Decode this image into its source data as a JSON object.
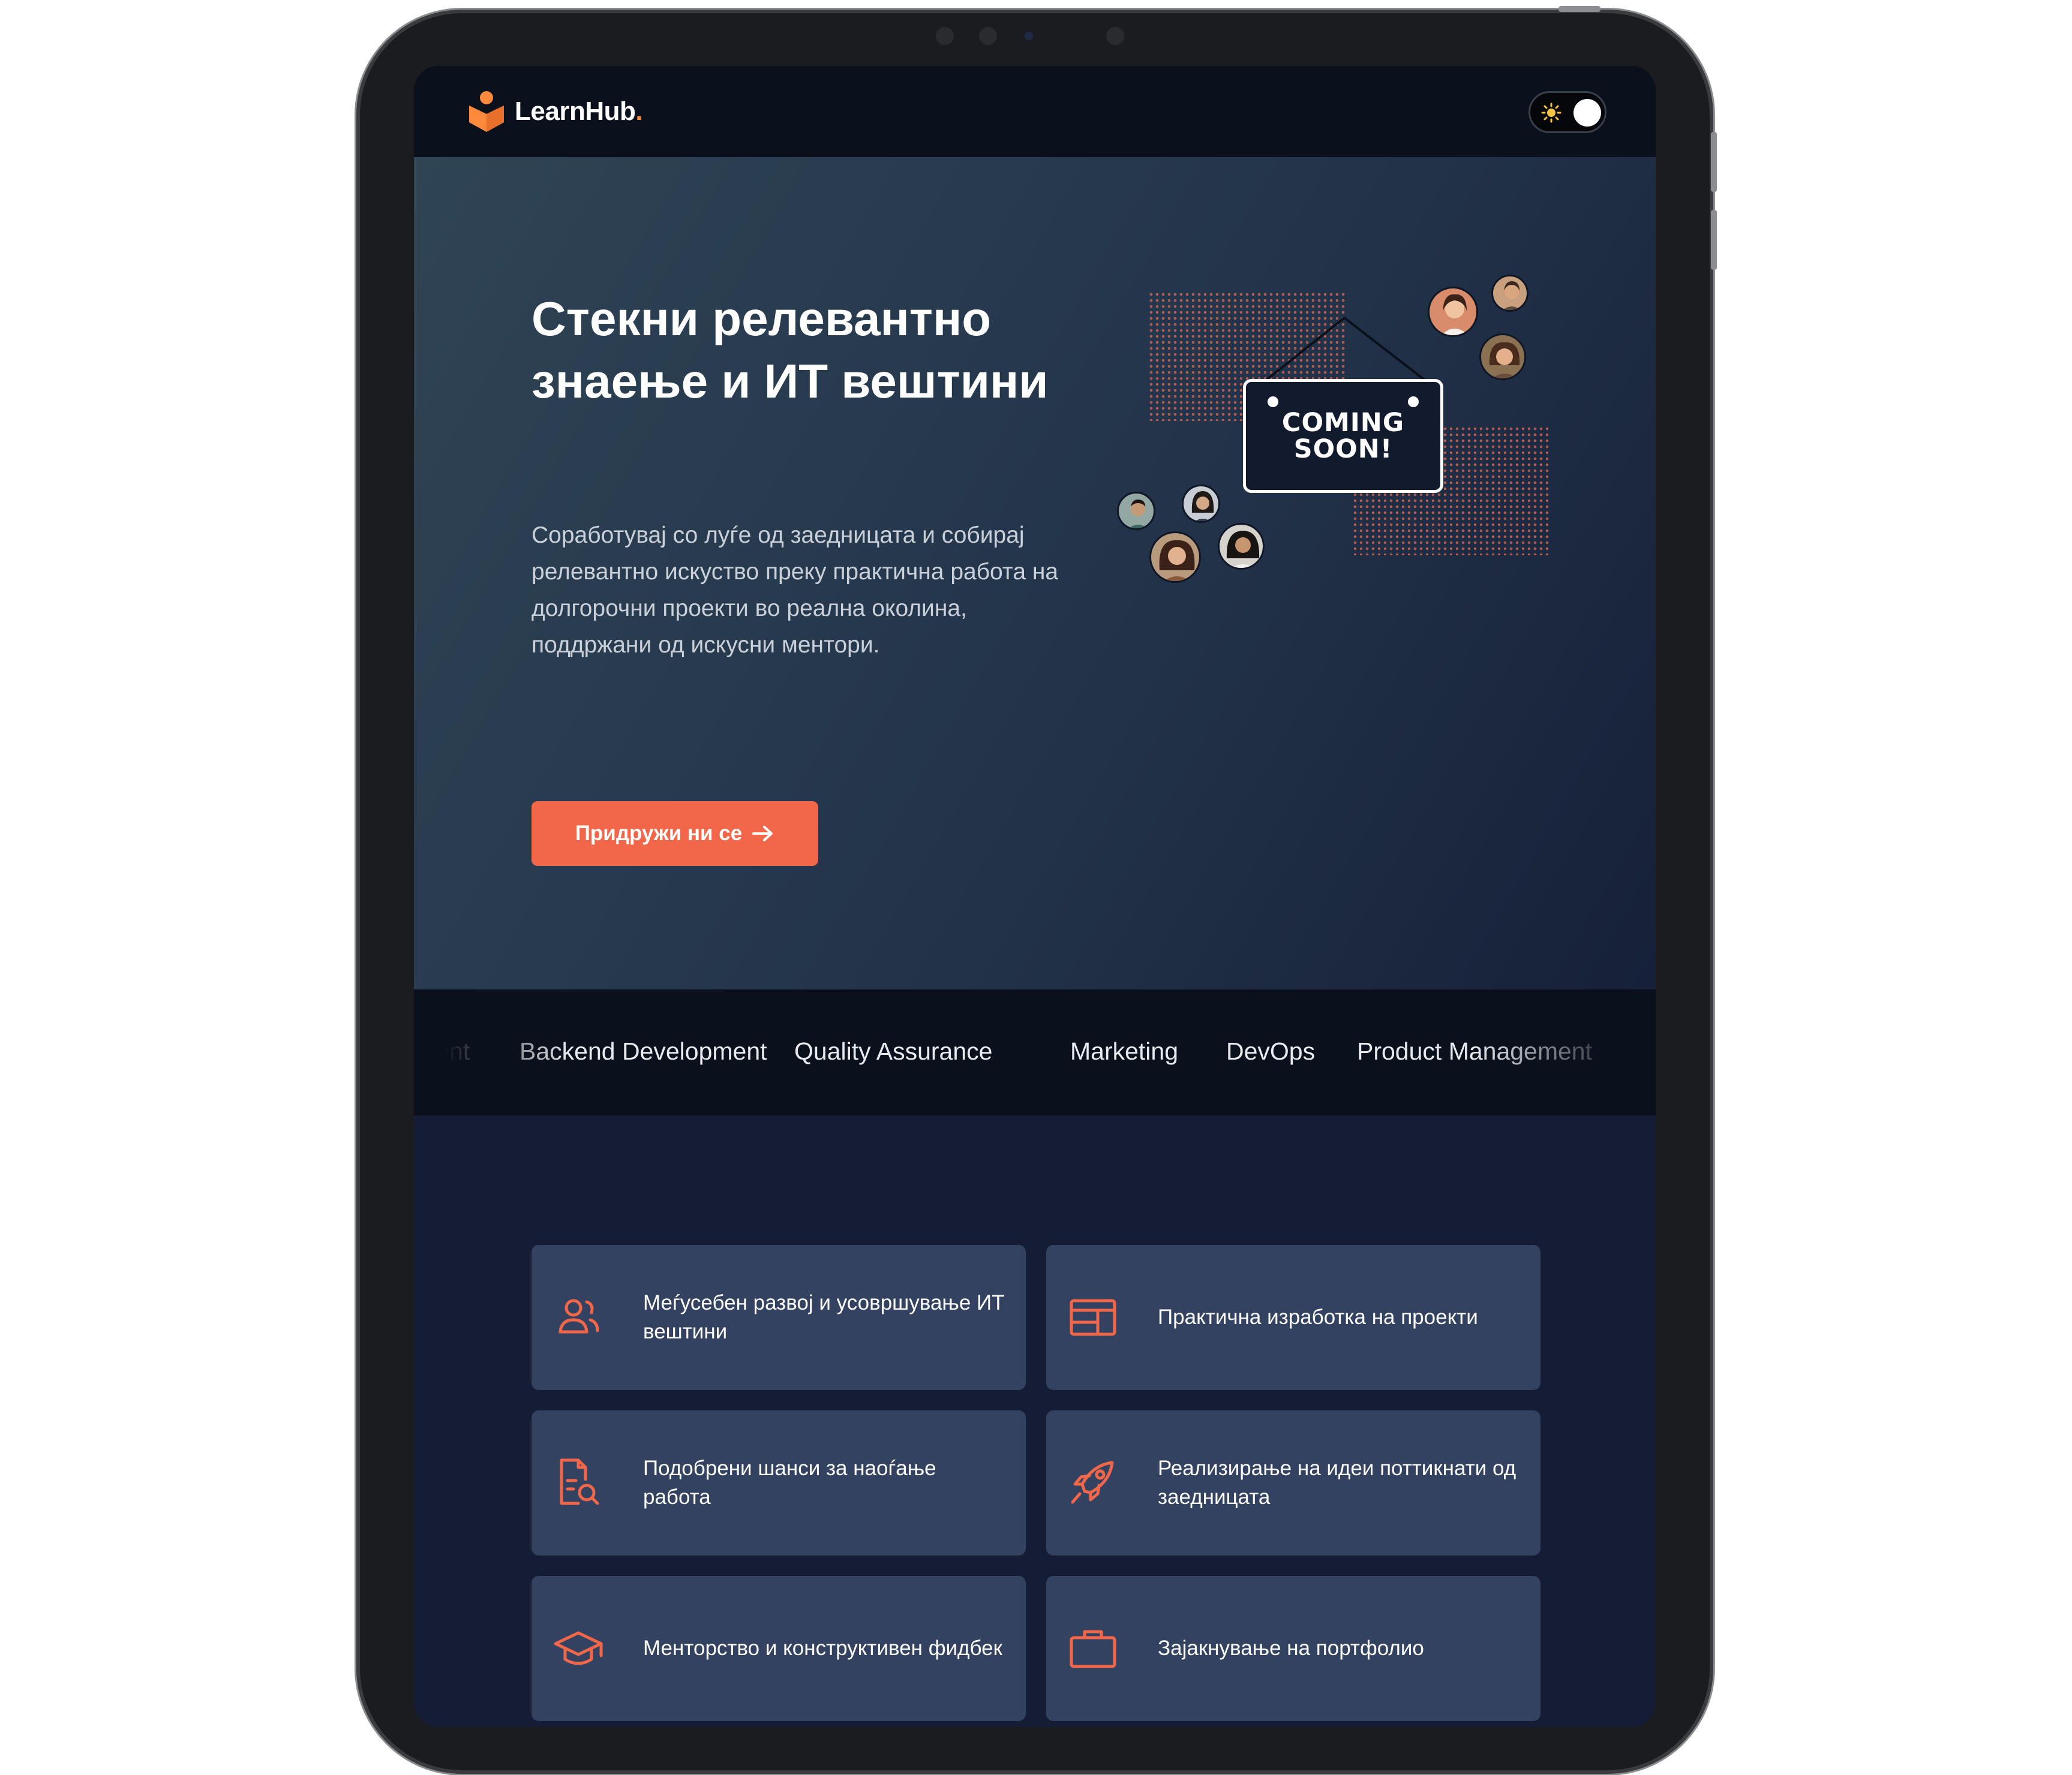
{
  "app": {
    "logo_text": "LearnHub",
    "logo_dot": ".",
    "theme_toggle_icon": "sun-icon"
  },
  "hero": {
    "title": "Стекни релевантно знаење и ИТ вештини",
    "description": "Соработувај со луѓе од заедницата и собирај релевантно искуство преку практична работа на долгорочни проекти во реална околина, поддржани од искусни ментори.",
    "cta_label": "Придружи ни се",
    "cta_icon": "arrow-right-icon",
    "sign_line1": "COMING",
    "sign_line2": "SOON!"
  },
  "marquee": {
    "items": [
      "ment",
      "Backend Development",
      "Quality Assurance",
      "Marketing",
      "DevOps",
      "Product Management"
    ]
  },
  "features": [
    {
      "icon": "users-icon",
      "label": "Меѓусебен развој и усовршување ИТ вештини"
    },
    {
      "icon": "layout-icon",
      "label": "Практична изработка на проекти"
    },
    {
      "icon": "document-search-icon",
      "label": "Подобрени шанси за наоѓање работа"
    },
    {
      "icon": "rocket-icon",
      "label": "Реализирање на идеи поттикнати од заедницата"
    },
    {
      "icon": "graduation-cap-icon",
      "label": "Менторство и конструктивен фидбек"
    },
    {
      "icon": "briefcase-icon",
      "label": "Зајакнување на портфолио"
    }
  ],
  "colors": {
    "accent": "#f26749",
    "brand_orange": "#ff8a3d",
    "header_bg": "#0b111c",
    "card_bg": "#334260",
    "page_bg": "#141d34"
  }
}
